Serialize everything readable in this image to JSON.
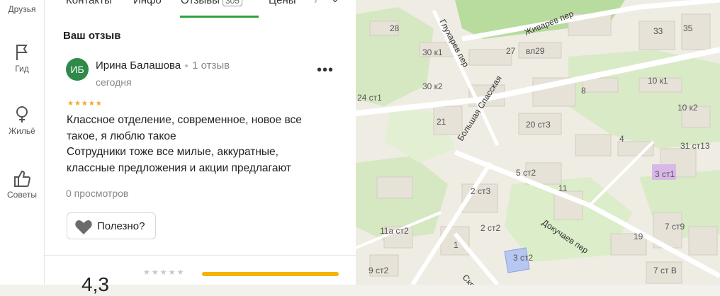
{
  "sidebar": {
    "items": [
      {
        "label": "Друзья",
        "icon": "friends-icon"
      },
      {
        "label": "Гид",
        "icon": "flag-icon"
      },
      {
        "label": "Жильё",
        "icon": "housing-icon"
      },
      {
        "label": "Советы",
        "icon": "thumbs-up-icon"
      }
    ]
  },
  "tabs": [
    {
      "label": "Контакты"
    },
    {
      "label": "Инфо"
    },
    {
      "label": "Отзывы",
      "count": "305"
    },
    {
      "label": "Цены"
    }
  ],
  "review": {
    "section_title": "Ваш отзыв",
    "avatar_initials": "ИБ",
    "author_name": "Ирина Балашова",
    "author_meta": "1 отзыв",
    "date": "сегодня",
    "menu": "•••",
    "stars": "★★★★★",
    "text": "Классное отделение, современное, новое все\nтакое, я люблю такое\nСотрудники тоже все милые, аккуратные,\nклассные предложения и акции предлагают",
    "views": "0 просмотров",
    "useful_label": "Полезно?"
  },
  "rating": {
    "value": "4,3",
    "stars": "★★★★★"
  },
  "map": {
    "labels": [
      "28",
      "30 к1",
      "27",
      "вл29",
      "33",
      "35",
      "Живарев пер",
      "Глухарев пер",
      "24 ст1",
      "30 к2",
      "Большая Спасская",
      "8",
      "10 к1",
      "10 к2",
      "21",
      "20 ст3",
      "4",
      "31 ст13",
      "5 ст2",
      "3 ст1",
      "2 ст3",
      "11",
      "2 ст2",
      "11а ст2",
      "Докучаев пер",
      "19",
      "7 ст9",
      "1",
      "3 ст2",
      "9 ст2",
      "7 ст В",
      "Скор"
    ]
  },
  "colors": {
    "accent": "#2aa43a",
    "avatar": "#2f8a4a",
    "stars": "#f5a623",
    "bar": "#f5b400"
  }
}
